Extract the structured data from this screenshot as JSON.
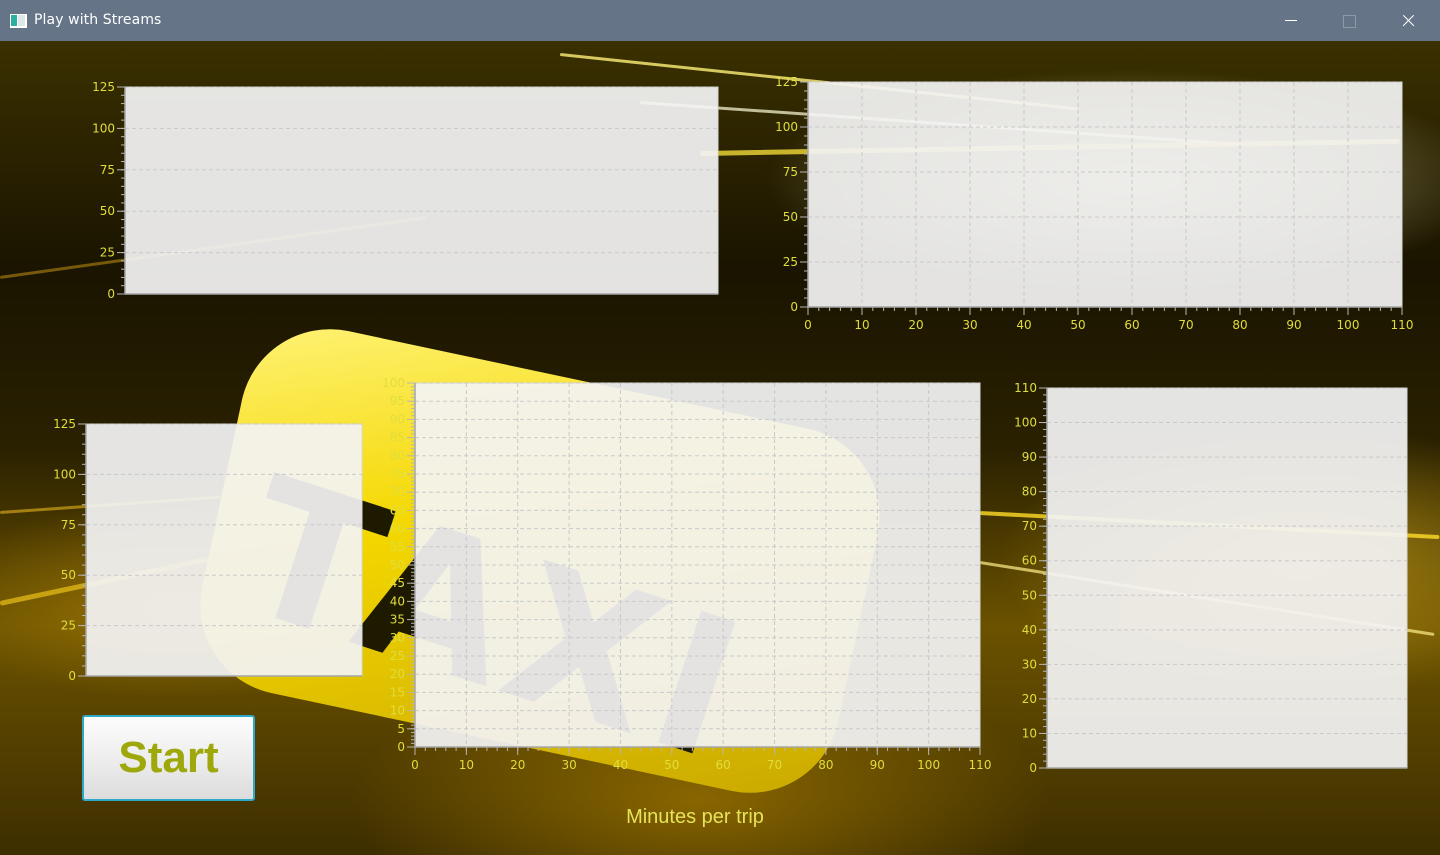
{
  "window": {
    "title": "Play with Streams",
    "icon": "window-app-icon",
    "controls": [
      "minimize-icon",
      "maximize-icon",
      "close-icon"
    ]
  },
  "background": {
    "description_icon": "taxi-night-background-image",
    "sign_text": "TAXI"
  },
  "start_button": {
    "label": "Start"
  },
  "x_axis_title": "Minutes per trip",
  "colors": {
    "titlebar": "#657487",
    "tick_label": "#e0dd3c",
    "axis_title": "#e6e35a",
    "start_label": "#9fa80a",
    "start_border": "#2ea8c8"
  },
  "chart_data": [
    {
      "id": "chart-top-left",
      "type": "line",
      "title": "",
      "xlabel": "",
      "ylabel": "",
      "ylim": [
        0,
        125
      ],
      "y_ticks": [
        "0",
        "25",
        "50",
        "75",
        "100",
        "125"
      ],
      "x_ticks": [],
      "series": [],
      "grid": true
    },
    {
      "id": "chart-top-right",
      "type": "line",
      "title": "",
      "xlabel": "",
      "ylabel": "",
      "xlim": [
        0,
        110
      ],
      "ylim": [
        0,
        125
      ],
      "y_ticks": [
        "0",
        "25",
        "50",
        "75",
        "100",
        "125"
      ],
      "x_ticks": [
        "0",
        "10",
        "20",
        "30",
        "40",
        "50",
        "60",
        "70",
        "80",
        "90",
        "100",
        "110"
      ],
      "series": [],
      "grid": true
    },
    {
      "id": "chart-bottom-left",
      "type": "line",
      "title": "",
      "xlabel": "",
      "ylabel": "",
      "ylim": [
        0,
        125
      ],
      "y_ticks": [
        "0",
        "25",
        "50",
        "75",
        "100",
        "125"
      ],
      "x_ticks": [],
      "series": [],
      "grid": true
    },
    {
      "id": "chart-center",
      "type": "bar",
      "title": "",
      "xlabel": "Minutes per trip",
      "ylabel": "",
      "xlim": [
        0,
        110
      ],
      "ylim": [
        0,
        100
      ],
      "y_ticks": [
        "0",
        "5",
        "10",
        "15",
        "20",
        "25",
        "30",
        "35",
        "40",
        "45",
        "50",
        "55",
        "60",
        "65",
        "70",
        "75",
        "80",
        "85",
        "90",
        "95",
        "100"
      ],
      "x_ticks": [
        "0",
        "10",
        "20",
        "30",
        "40",
        "50",
        "60",
        "70",
        "80",
        "90",
        "100",
        "110"
      ],
      "series": [],
      "grid": true
    },
    {
      "id": "chart-right",
      "type": "line",
      "title": "",
      "xlabel": "",
      "ylabel": "",
      "ylim": [
        0,
        110
      ],
      "y_ticks": [
        "0",
        "10",
        "20",
        "30",
        "40",
        "50",
        "60",
        "70",
        "80",
        "90",
        "100",
        "110"
      ],
      "x_ticks": [],
      "series": [],
      "grid": true
    }
  ]
}
